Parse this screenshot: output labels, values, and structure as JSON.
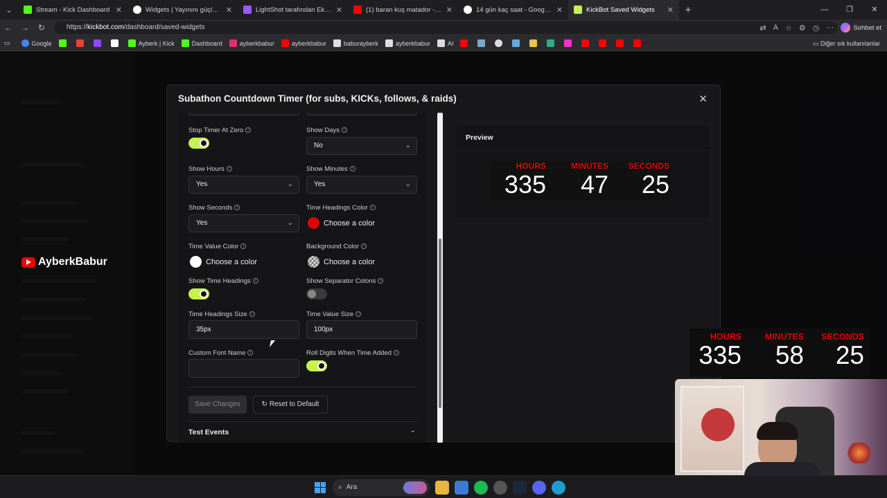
{
  "browser": {
    "tabs": [
      {
        "label": "Stream - Kick Dashboard",
        "color": "#53fc18",
        "active": false
      },
      {
        "label": "Widgets | Yayınını güçlendirmek i",
        "color": "#ffffff",
        "active": false
      },
      {
        "label": "LightShot tarafından Ekran Görün",
        "color": "#9b5cff",
        "active": false
      },
      {
        "label": "(1) baran kuş matador - YouTube",
        "color": "#ff0000",
        "active": false
      },
      {
        "label": "14 gün kaç saat - Google'da Ara",
        "color": "#ffffff",
        "active": false
      },
      {
        "label": "KickBot Saved Widgets",
        "color": "#c6f24e",
        "active": true
      }
    ],
    "url_prefix": "https://",
    "url_host": "kickbot.com",
    "url_path": "/dashboard/saved-widgets",
    "copilot_label": "Sohbet et",
    "bookmarks": [
      {
        "label": "Google",
        "color": "#4285f4"
      },
      {
        "label": "",
        "color": "#53fc18"
      },
      {
        "label": "",
        "color": "#ea4335"
      },
      {
        "label": "",
        "color": "#9146ff"
      },
      {
        "label": "",
        "color": "#ffffff"
      },
      {
        "label": "Ayberk | Kick",
        "color": "#53fc18"
      },
      {
        "label": "Dashboard",
        "color": "#53fc18"
      },
      {
        "label": "ayberkbabur",
        "color": "#e1306c"
      },
      {
        "label": "ayberkbabur",
        "color": "#ff0000"
      },
      {
        "label": "baburayberk",
        "color": "#ffffff"
      },
      {
        "label": "ayberkbabur",
        "color": "#ffffff"
      },
      {
        "label": "AI",
        "color": "#ffffff"
      }
    ],
    "bookmarks_other": "Diğer sık kullanılanlar"
  },
  "overlay_channel": "AyberkBabur",
  "modal": {
    "title": "Subathon Countdown Timer (for subs, KICKs, follows, & raids)",
    "fields": {
      "stop_timer_at_zero": {
        "label": "Stop Timer At Zero",
        "on": true
      },
      "show_days": {
        "label": "Show Days",
        "value": "No"
      },
      "show_hours": {
        "label": "Show Hours",
        "value": "Yes"
      },
      "show_minutes": {
        "label": "Show Minutes",
        "value": "Yes"
      },
      "show_seconds": {
        "label": "Show Seconds",
        "value": "Yes"
      },
      "time_headings_color": {
        "label": "Time Headings Color",
        "button": "Choose a color",
        "color": "#e00000"
      },
      "time_value_color": {
        "label": "Time Value Color",
        "button": "Choose a color",
        "color": "#ffffff"
      },
      "background_color": {
        "label": "Background Color",
        "button": "Choose a color"
      },
      "show_time_headings": {
        "label": "Show Time Headings",
        "on": true
      },
      "show_separator_colons": {
        "label": "Show Separator Colons",
        "on": false
      },
      "time_headings_size": {
        "label": "Time Headings Size",
        "value": "35px"
      },
      "time_value_size": {
        "label": "Time Value Size",
        "value": "100px"
      },
      "custom_font_name": {
        "label": "Custom Font Name",
        "value": ""
      },
      "roll_digits": {
        "label": "Roll Digits When Time Added",
        "on": true
      }
    },
    "save_button": "Save Changes",
    "reset_button": "Reset to Default",
    "test_events": "Test Events",
    "preview_title": "Preview",
    "preview_timer": {
      "hours_label": "HOURS",
      "hours": "335",
      "minutes_label": "MINUTES",
      "minutes": "47",
      "seconds_label": "SECONDS",
      "seconds": "25"
    }
  },
  "stream_timer": {
    "hours_label": "HOURS",
    "hours": "335",
    "minutes_label": "MINUTES",
    "minutes": "58",
    "seconds_label": "SECONDS",
    "seconds": "25"
  },
  "taskbar": {
    "search_label": "Ara"
  },
  "colors": {
    "accent": "#c6f24e",
    "heading_red": "#e00000"
  }
}
